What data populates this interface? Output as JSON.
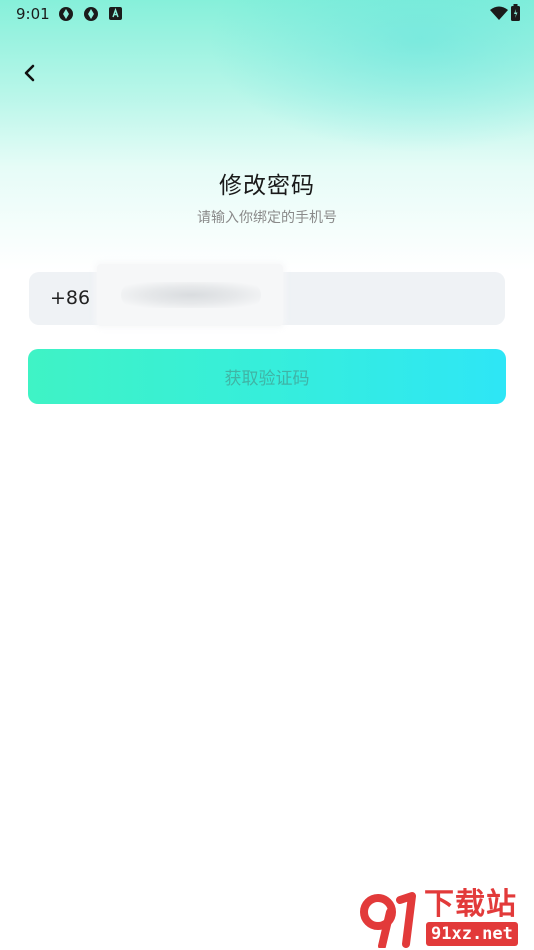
{
  "status_bar": {
    "time": "9:01",
    "icons": [
      "aperture-icon",
      "aperture-icon",
      "a-box-icon",
      "wifi-icon",
      "battery-icon"
    ]
  },
  "header": {
    "back_icon": "chevron-left-icon"
  },
  "main": {
    "title": "修改密码",
    "subtitle": "请输入你绑定的手机号",
    "phone": {
      "country_code": "+86",
      "value": "",
      "placeholder": ""
    },
    "get_code_button": "获取验证码"
  },
  "watermark": {
    "top_text": "下载站",
    "bottom_text": "91xz.net"
  },
  "colors": {
    "button_start": "#3ff3c5",
    "button_end": "#2ee6f6",
    "field_bg": "#eff2f5",
    "watermark_red": "#e23a3a"
  }
}
